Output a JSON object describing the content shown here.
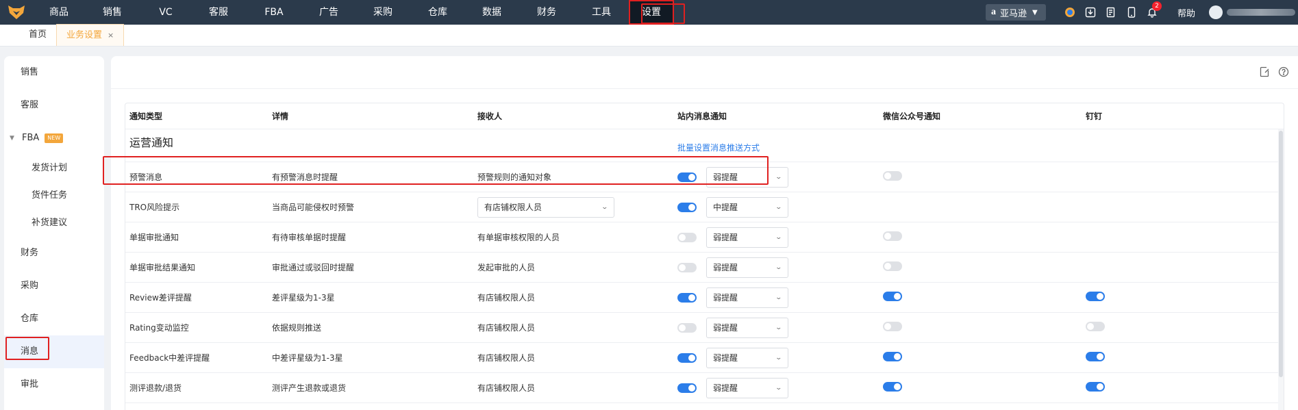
{
  "nav": {
    "items": [
      {
        "label": "商品",
        "width": 76
      },
      {
        "label": "销售",
        "width": 80
      },
      {
        "label": "VC",
        "width": 76
      },
      {
        "label": "客服",
        "width": 78
      },
      {
        "label": "FBA",
        "width": 84
      },
      {
        "label": "广告",
        "width": 76
      },
      {
        "label": "采购",
        "width": 82
      },
      {
        "label": "仓库",
        "width": 78
      },
      {
        "label": "数据",
        "width": 80
      },
      {
        "label": "财务",
        "width": 80
      },
      {
        "label": "工具",
        "width": 80
      },
      {
        "label": "设置",
        "width": 66
      }
    ],
    "active": "设置",
    "market": "亚马逊",
    "market_logo": "a",
    "notification_count": "2",
    "help": "帮助"
  },
  "tabs": {
    "home": "首页",
    "current": "业务设置",
    "close": "×"
  },
  "sidebar": {
    "items": {
      "sales": "销售",
      "service": "客服",
      "fba": "FBA",
      "fba_badge": "NEW",
      "shipping_plan": "发货计划",
      "shipment_task": "货件任务",
      "replenish": "补货建议",
      "finance": "财务",
      "purchase": "采购",
      "warehouse": "仓库",
      "message": "消息",
      "approval": "审批"
    },
    "active": "消息"
  },
  "table": {
    "headers": {
      "type": "通知类型",
      "detail": "详情",
      "receiver": "接收人",
      "site_msg": "站内消息通知",
      "wechat": "微信公众号通知",
      "dingtalk": "钉钉"
    },
    "section": {
      "title": "运营通知",
      "batch_link": "批量设置消息推送方式"
    },
    "rows": [
      {
        "type": "预警消息",
        "detail": "有预警消息时提醒",
        "receiver": "预警规则的通知对象",
        "receiver_select": false,
        "site_on": true,
        "level": "弱提醒",
        "wechat": "off",
        "dingtalk": "none"
      },
      {
        "type": "TRO风险提示",
        "detail": "当商品可能侵权时预警",
        "receiver": "有店铺权限人员",
        "receiver_select": true,
        "site_on": true,
        "level": "中提醒",
        "wechat": "none",
        "dingtalk": "none",
        "highlighted": true
      },
      {
        "type": "单据审批通知",
        "detail": "有待审核单据时提醒",
        "receiver": "有单据审核权限的人员",
        "receiver_select": false,
        "site_on": false,
        "level": "弱提醒",
        "wechat": "off",
        "dingtalk": "none"
      },
      {
        "type": "单据审批结果通知",
        "detail": "审批通过或驳回时提醒",
        "receiver": "发起审批的人员",
        "receiver_select": false,
        "site_on": false,
        "level": "弱提醒",
        "wechat": "off",
        "dingtalk": "none"
      },
      {
        "type": "Review差评提醒",
        "detail": "差评星级为1-3星",
        "receiver": "有店铺权限人员",
        "receiver_select": false,
        "site_on": true,
        "level": "弱提醒",
        "wechat": "on",
        "dingtalk": "on"
      },
      {
        "type": "Rating变动监控",
        "detail": "依据规则推送",
        "receiver": "有店铺权限人员",
        "receiver_select": false,
        "site_on": false,
        "level": "弱提醒",
        "wechat": "off",
        "dingtalk": "off"
      },
      {
        "type": "Feedback中差评提醒",
        "detail": "中差评星级为1-3星",
        "receiver": "有店铺权限人员",
        "receiver_select": false,
        "site_on": true,
        "level": "弱提醒",
        "wechat": "on",
        "dingtalk": "on"
      },
      {
        "type": "测评退款/退货",
        "detail": "测评产生退款或退货",
        "receiver": "有店铺权限人员",
        "receiver_select": false,
        "site_on": true,
        "level": "弱提醒",
        "wechat": "on",
        "dingtalk": "on"
      }
    ]
  },
  "colors": {
    "nav_bg": "#2b3a4b",
    "accent": "#2b7de9",
    "tab_active": "#f3a63b",
    "highlight": "#e02020"
  }
}
